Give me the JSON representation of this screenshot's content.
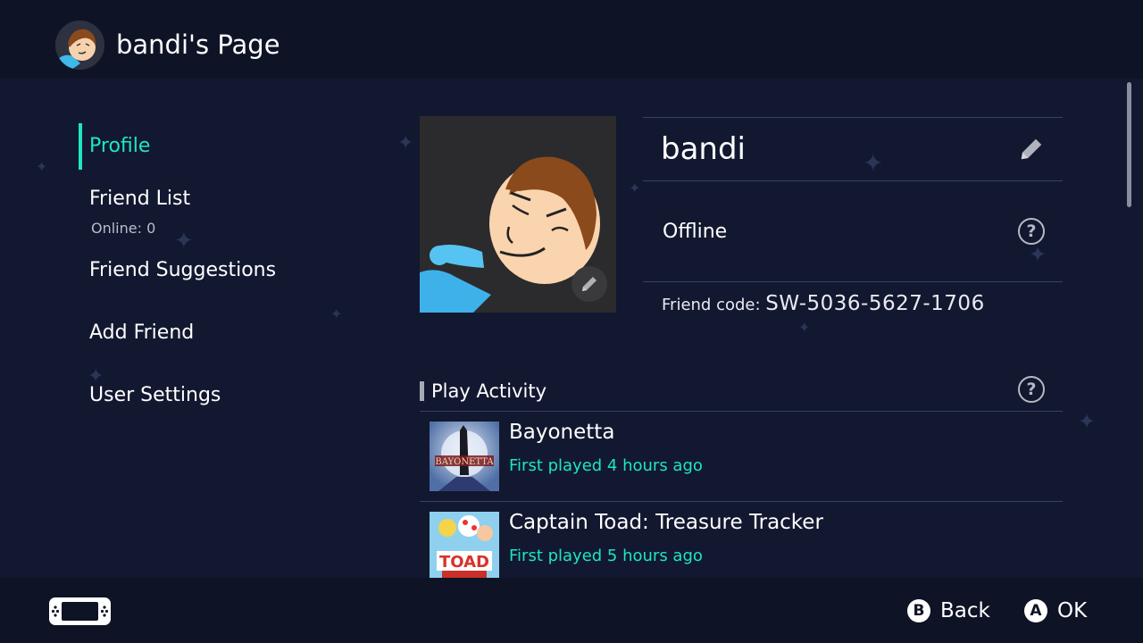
{
  "header": {
    "title": "bandi's Page"
  },
  "sidebar": {
    "items": [
      {
        "label": "Profile",
        "active": true
      },
      {
        "label": "Friend List",
        "sub": "Online: 0"
      },
      {
        "label": "Friend Suggestions"
      },
      {
        "label": "Add Friend"
      },
      {
        "label": "User Settings"
      }
    ]
  },
  "profile": {
    "name": "bandi",
    "status": "Offline",
    "friend_code_label": "Friend code:",
    "friend_code": "SW-5036-5627-1706"
  },
  "play_activity": {
    "title": "Play Activity",
    "games": [
      {
        "name": "Bayonetta",
        "first_played": "First played 4 hours ago"
      },
      {
        "name": "Captain Toad: Treasure Tracker",
        "first_played": "First played 5 hours ago"
      }
    ]
  },
  "footer": {
    "back_key": "B",
    "back_label": "Back",
    "ok_key": "A",
    "ok_label": "OK"
  },
  "colors": {
    "accent": "#1ee6c1",
    "background": "#121830",
    "bar": "#0e1326"
  }
}
